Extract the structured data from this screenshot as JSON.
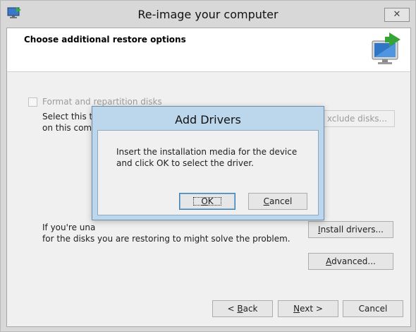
{
  "window": {
    "title": "Re-image your computer",
    "close_glyph": "✕",
    "app_icon": "system-restore-icon"
  },
  "header": {
    "title": "Choose additional restore options",
    "icon": "computer-restore-icon"
  },
  "format_option": {
    "label": "Format and repartition disks",
    "checked": false,
    "enabled": false,
    "description_line1": "Select this to",
    "description_line2": "on this compu"
  },
  "buttons": {
    "exclude_disks": "xclude disks...",
    "install_drivers_prefix": "",
    "install_drivers_u": "I",
    "install_drivers_rest": "nstall drivers...",
    "advanced_u": "A",
    "advanced_rest": "dvanced..."
  },
  "drivers_note": {
    "line1": "If you're una",
    "line2": "for the disks you are restoring to might solve the problem."
  },
  "footer": {
    "back_prefix": "< ",
    "back_u": "B",
    "back_rest": "ack",
    "next_u": "N",
    "next_rest": "ext >",
    "cancel": "Cancel"
  },
  "dialog": {
    "title": "Add Drivers",
    "message": "Insert the installation media for the device and click OK to select the driver.",
    "ok_u": "O",
    "ok_rest": "K",
    "cancel_u": "C",
    "cancel_rest": "ancel"
  },
  "colors": {
    "title_bar": "#d8d8d8",
    "content_bg": "#f0f0f0",
    "dialog_frame": "#bcd6ec",
    "default_button_border": "#3c7fb1"
  }
}
